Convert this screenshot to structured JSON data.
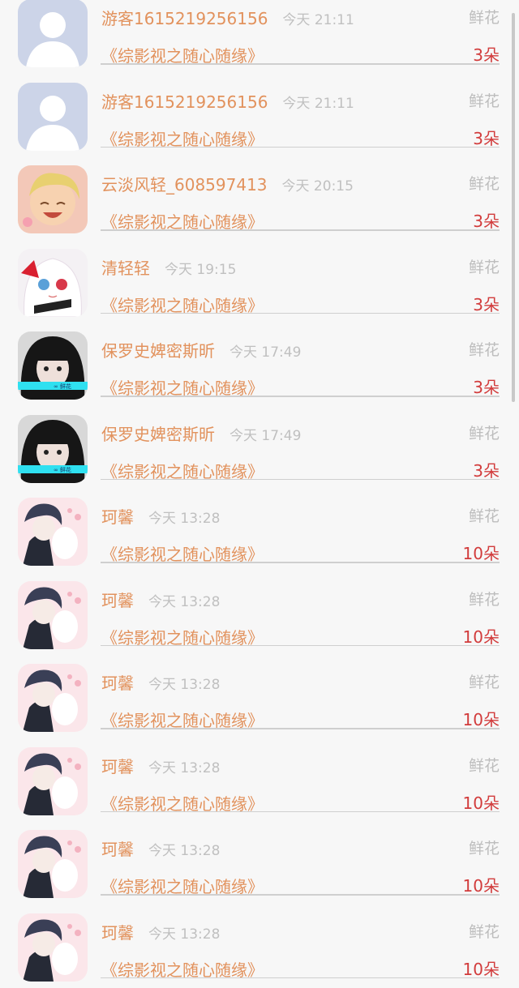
{
  "gift_label": "鲜花",
  "rows": [
    {
      "name": "游客1615219256156",
      "time": "今天 21:11",
      "book": "《综影视之随心随缘》",
      "count": "3朵",
      "avatar": "default-avatar"
    },
    {
      "name": "游客1615219256156",
      "time": "今天 21:11",
      "book": "《综影视之随心随缘》",
      "count": "3朵",
      "avatar": "default-avatar"
    },
    {
      "name": "云淡风轻_608597413",
      "time": "今天 20:15",
      "book": "《综影视之随心随缘》",
      "count": "3朵",
      "avatar": "blond-cartoon-avatar"
    },
    {
      "name": "清轻轻",
      "time": "今天 19:15",
      "book": "《综影视之随心随缘》",
      "count": "3朵",
      "avatar": "anime-girl-avatar"
    },
    {
      "name": "保罗史婢密斯昕",
      "time": "今天 17:49",
      "book": "《综影视之随心随缘》",
      "count": "3朵",
      "avatar": "girl-photo-avatar"
    },
    {
      "name": "保罗史婢密斯昕",
      "time": "今天 17:49",
      "book": "《综影视之随心随缘》",
      "count": "3朵",
      "avatar": "girl-photo-avatar"
    },
    {
      "name": "珂馨",
      "time": "今天 13:28",
      "book": "《综影视之随心随缘》",
      "count": "10朵",
      "avatar": "anime-boy-avatar"
    },
    {
      "name": "珂馨",
      "time": "今天 13:28",
      "book": "《综影视之随心随缘》",
      "count": "10朵",
      "avatar": "anime-boy-avatar"
    },
    {
      "name": "珂馨",
      "time": "今天 13:28",
      "book": "《综影视之随心随缘》",
      "count": "10朵",
      "avatar": "anime-boy-avatar"
    },
    {
      "name": "珂馨",
      "time": "今天 13:28",
      "book": "《综影视之随心随缘》",
      "count": "10朵",
      "avatar": "anime-boy-avatar"
    },
    {
      "name": "珂馨",
      "time": "今天 13:28",
      "book": "《综影视之随心随缘》",
      "count": "10朵",
      "avatar": "anime-boy-avatar"
    },
    {
      "name": "珂馨",
      "time": "今天 13:28",
      "book": "《综影视之随心随缘》",
      "count": "10朵",
      "avatar": "anime-boy-avatar"
    }
  ],
  "colors": {
    "name": "#e2925d",
    "count": "#d23c3c",
    "muted": "#bdbdbd"
  },
  "avatar_overlay_text": "∞ 鲜花"
}
